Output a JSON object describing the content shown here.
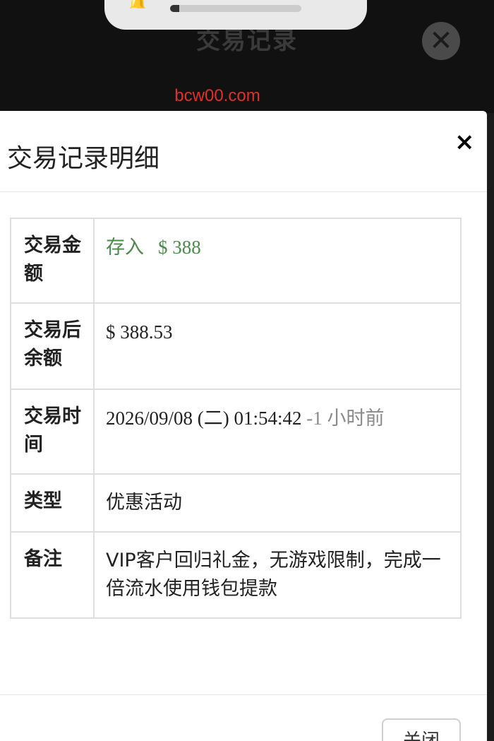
{
  "background": {
    "title": "交易记录",
    "watermark": "bcw00.com"
  },
  "notification": {
    "icon": "bell-icon",
    "progress": 0.07
  },
  "modal": {
    "title": "交易记录明细",
    "close_symbol": "×",
    "footer_button": "关闭",
    "rows": [
      {
        "label": "交易金额",
        "type_text": "存入",
        "amount": "$ 388"
      },
      {
        "label": "交易后余额",
        "value": "$ 388.53"
      },
      {
        "label": "交易时间",
        "datetime": "2026/09/08 (二) 01:54:42",
        "relative": "-1 小时前"
      },
      {
        "label": "类型",
        "value": "优惠活动"
      },
      {
        "label": "备注",
        "value": "VIP客户回归礼金，无游戏限制，完成一倍流水使用钱包提款"
      }
    ]
  },
  "colors": {
    "deposit_green": "#4a8a4a",
    "watermark_red": "#e0302a"
  }
}
